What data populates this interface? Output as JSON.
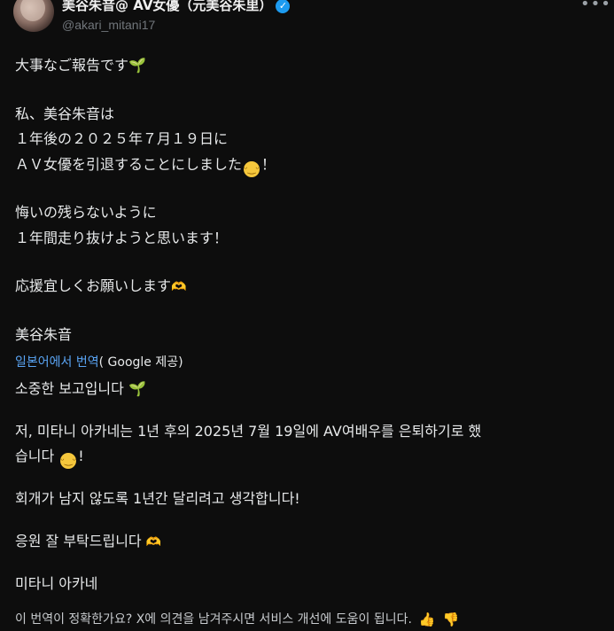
{
  "user": {
    "display_name": "美谷朱音@ AV女優（元美谷朱里）",
    "handle": "@akari_mitani17",
    "more_icon": "more-dots-icon",
    "verified_icon": "verified-badge-icon"
  },
  "tweet": {
    "lines": [
      "大事なご報告です",
      "私、美谷朱音は",
      "１年後の２０２５年７月１９日に",
      "ＡＶ女優を引退することにしました",
      "悔いの残らないように",
      "１年間走り抜けようと思います！",
      "応援宜しくお願いします",
      "美谷朱音"
    ],
    "line4_suffix": "！"
  },
  "translation": {
    "link_text": "일본어에서 번역",
    "source_text": "( Google 제공)"
  },
  "translated": {
    "l1": "소중한 보고입니다",
    "l2a": "저, 미타니 아카네는 1년 후의 2025년 7월 19일에 AV여배우를 은퇴하기로 했",
    "l2b": "습니다",
    "l2b_suffix": "!",
    "l3": "회개가 남지 않도록 1년간 달리려고 생각합니다!",
    "l4": "응원 잘 부탁드립니다",
    "l5": "미타니 아카네"
  },
  "feedback": {
    "question": "이 번역이 정확한가요? X에 의견을 남겨주시면 서비스 개선에 도움이 됩니다.",
    "thumbs_up_icon": "thumbs-up-icon",
    "thumbs_down_icon": "thumbs-down-icon"
  },
  "colors": {
    "background": "#0d0d0d",
    "text": "#e7e9ea",
    "secondary": "#71767b",
    "link": "#5aa5f5",
    "verified": "#1d9bf0"
  }
}
